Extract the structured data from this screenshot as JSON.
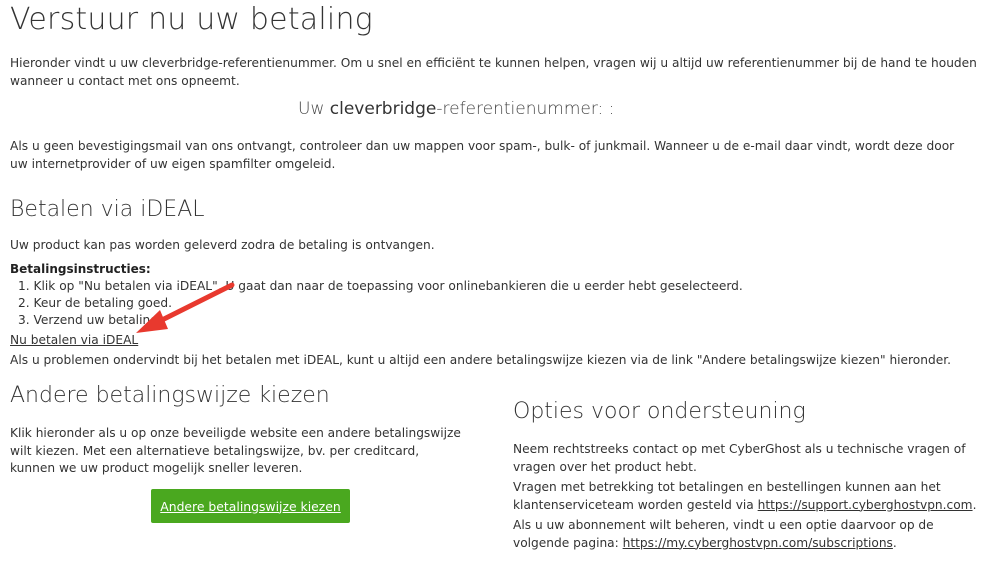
{
  "page": {
    "title": "Verstuur nu uw betaling",
    "intro": "Hieronder vindt u uw cleverbridge-referentienummer. Om u snel en efficiënt te kunnen helpen, vragen wij u altijd uw referentienummer bij de hand te houden wanneer u contact met ons opneemt.",
    "ref_prefix": "Uw ",
    "ref_brand": "cleverbridge",
    "ref_suffix": "-referentienummer: :",
    "spam_note": "Als u geen bevestigingsmail van ons ontvangt, controleer dan uw mappen voor spam-, bulk- of junkmail. Wanneer u de e-mail daar vindt, wordt deze door uw internetprovider of uw eigen spamfilter omgeleid."
  },
  "ideal": {
    "heading": "Betalen via iDEAL",
    "delivery_note": "Uw product kan pas worden geleverd zodra de betaling is ontvangen.",
    "instructions_label": "Betalingsinstructies:",
    "steps": [
      "1. Klik op \"Nu betalen via iDEAL\". U gaat dan naar de toepassing voor onlinebankieren die u eerder hebt geselecteerd.",
      "2. Keur de betaling goed.",
      "3. Verzend uw betaling."
    ],
    "pay_link": "Nu betalen via iDEAL",
    "problem_note": "Als u problemen ondervindt bij het betalen met iDEAL, kunt u altijd een andere betalingswijze kiezen via de link \"Andere betalingswijze kiezen\" hieronder."
  },
  "other": {
    "heading": "Andere betalingswijze kiezen",
    "text": "Klik hieronder als u op onze beveiligde website een andere betalingswijze wilt kiezen. Met een alternatieve betalingswijze, bv. per creditcard, kunnen we uw product mogelijk sneller leveren.",
    "button_label": "Andere betalingswijze kiezen"
  },
  "support": {
    "heading": "Opties voor ondersteuning",
    "contact_text": "Neem rechtstreeks contact op met CyberGhost als u technische vragen of vragen over het product hebt.",
    "billing_text": "Vragen met betrekking tot betalingen en bestellingen kunnen aan het klantenserviceteam worden gesteld via ",
    "support_link": "https://support.cyberghostvpn.com",
    "subscription_text": "Als u uw abonnement wilt beheren, vindt u een optie daarvoor op de volgende pagina: ",
    "subscription_link": "https://my.cyberghostvpn.com/subscriptions"
  },
  "colors": {
    "button_bg": "#4aa81f",
    "arrow": "#e8392e"
  }
}
